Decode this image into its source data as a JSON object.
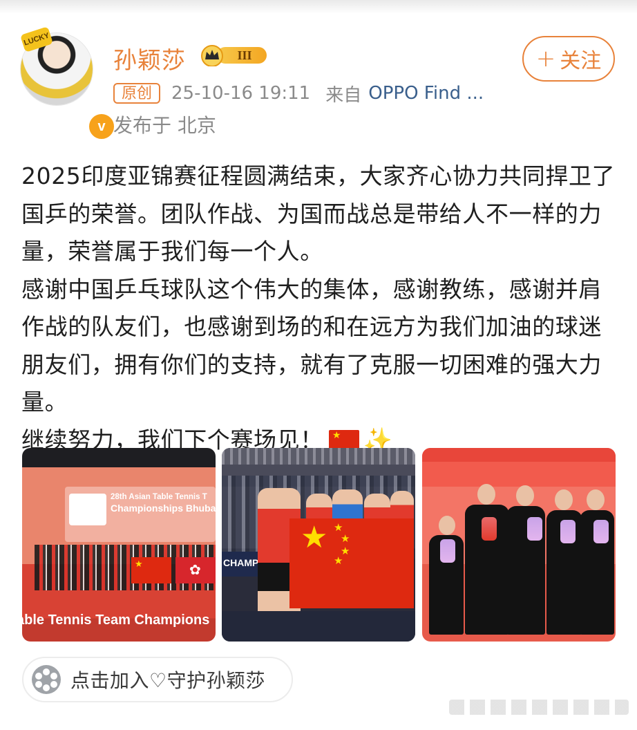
{
  "post": {
    "author": {
      "name": "孙颖莎",
      "vip_level": "III",
      "avatar_sticker": "LUCKY",
      "verified_mark": "v"
    },
    "follow_label": "关注",
    "original_tag": "原创",
    "timestamp": "25-10-16 19:11",
    "source_prefix": "来自",
    "source_device": "OPPO Find ...",
    "location": "发布于 北京",
    "paragraphs": [
      "2025印度亚锦赛征程圆满结束，大家齐心协力共同捍卫了国乒的荣誉。团队作战、为国而战总是带给人不一样的力量，荣誉属于我们每一个人。",
      "感谢中国乒乓球队这个伟大的集体，感谢教练，感谢并肩作战的队友们，也感谢到场的和在远方为我们加油的球迷朋友们，拥有你们的支持，就有了克服一切困难的强大力量。",
      "继续努力，我们下个赛场见！"
    ],
    "photos": [
      {
        "screen_title_line1": "28th Asian Table Tennis T",
        "screen_title_line2": "Championships Bhuban",
        "banner_text": "able Tennis Team Champions"
      },
      {
        "board_text": "CHAMPIO"
      },
      {}
    ],
    "join_text": "点击加入♡守护孙颖莎"
  },
  "icons": {
    "follow": "plus-icon",
    "vip": "crown-icon",
    "join": "fan-club-icon",
    "emoji1": "china-flag-emoji",
    "emoji2": "sparkles-emoji"
  },
  "colors": {
    "accent": "#e8823a",
    "link": "#3a5f8c",
    "meta": "#8a8a8a",
    "vip_gold": "#f3a622",
    "verified": "#f7a21b"
  }
}
